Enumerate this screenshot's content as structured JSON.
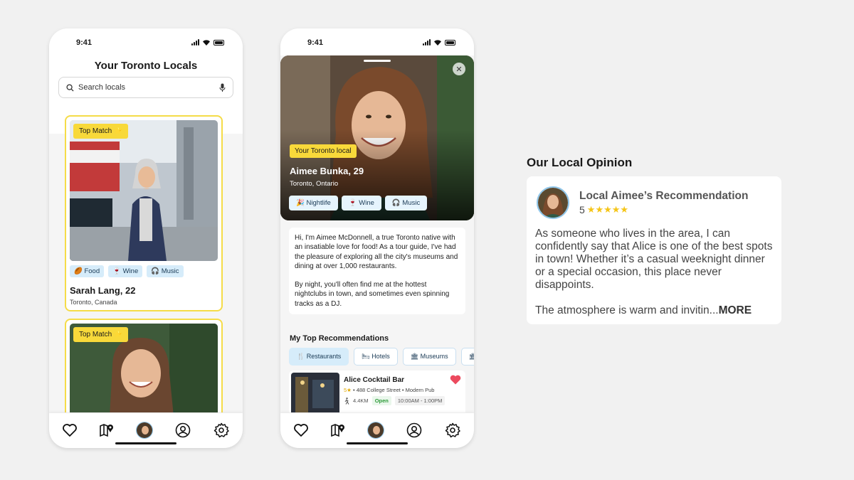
{
  "status": {
    "time": "9:41"
  },
  "screen1": {
    "title": "Your Toronto Locals",
    "search": {
      "placeholder": "Search locals",
      "value": ""
    },
    "cards": [
      {
        "badge": "Top Match ⭐",
        "tags": [
          "🏉 Food",
          "🍷 Wine",
          "🎧 Music"
        ],
        "name": "Sarah Lang, 22",
        "location": "Toronto, Canada"
      },
      {
        "badge": "Top Match ⭐"
      }
    ]
  },
  "screen2": {
    "badge": "Your Toronto local",
    "name": "Aimee Bunka, 29",
    "location": "Toronto, Ontario",
    "tags": [
      "🎉 Nightlife",
      "🍷 Wine",
      "🎧 Music"
    ],
    "close_label": "✕",
    "bio": [
      "Hi, I'm Aimee McDonnell, a true Toronto native with an insatiable love for food! As a tour guide, I've had the pleasure of exploring all the city's museums and dining at over 1,000 restaurants.",
      "By night, you'll often find me at the hottest nightclubs in town, and sometimes even spinning tracks as a DJ."
    ],
    "recommendations_title": "My Top Recommendations",
    "rec_tabs": [
      "Restaurants",
      "Hotels",
      "Museums"
    ],
    "place": {
      "name": "Alice Cocktail Bar",
      "rating": "5★",
      "meta": " • 488 College Street • Modern Pub",
      "distance": "4.4KM",
      "open": "Open",
      "hours": "10:00AM - 1:00PM"
    }
  },
  "opinion": {
    "heading": "Our Local Opinion",
    "title": "Local Aimee’s Recommendation",
    "rating": "5",
    "stars": "★★★★★",
    "paragraph1": "As someone who lives in the area, I can confidently say that Alice is one of the best spots in town! Whether it’s a casual weeknight dinner or a special occasion, this place never disappoints.",
    "paragraph2": "The atmosphere is warm and invitin...",
    "more": "MORE"
  },
  "colors": {
    "accent_yellow": "#f8d93a",
    "card_border": "#f5dc48",
    "chip_blue": "#d6ecfa",
    "heart_red": "#ec4a5e",
    "open_green": "#2e9b3a"
  },
  "icons": [
    "search-icon",
    "microphone-icon",
    "heart-icon",
    "map-pin-icon",
    "user-circle-icon",
    "gear-icon",
    "close-icon",
    "walk-icon"
  ]
}
